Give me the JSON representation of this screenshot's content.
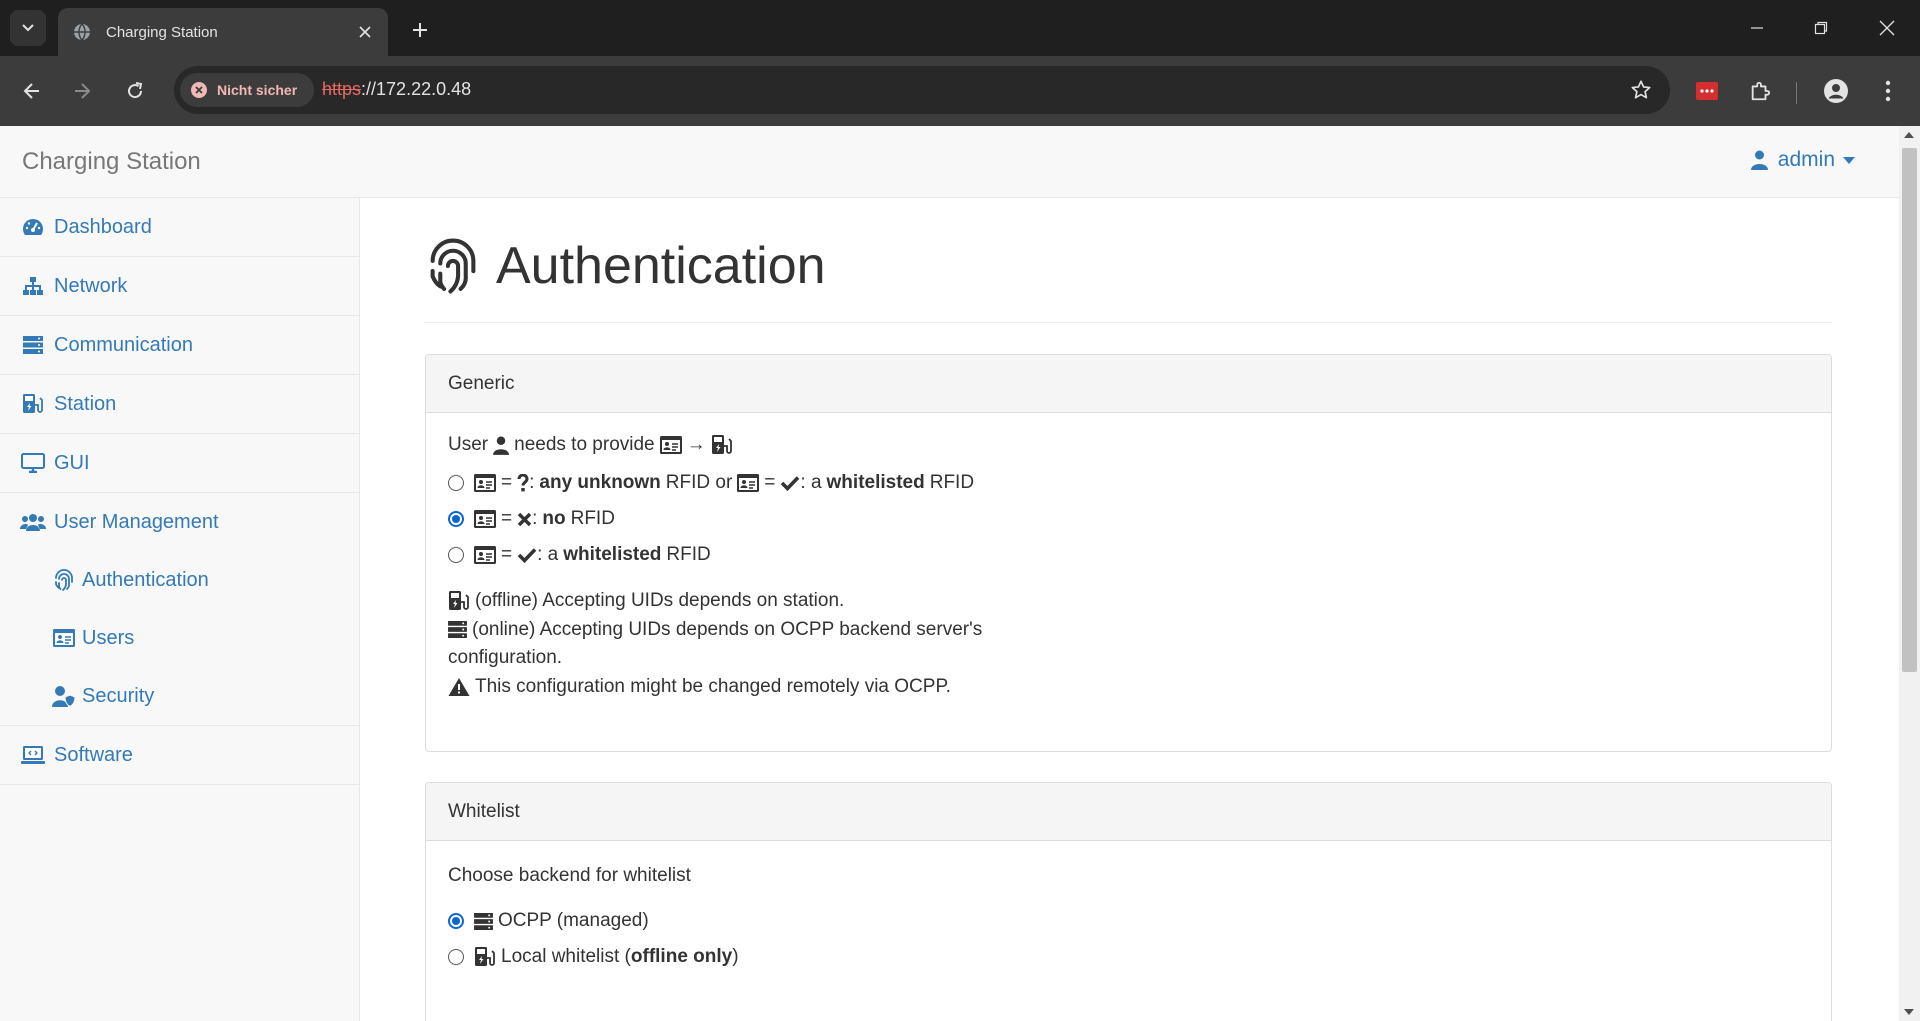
{
  "browser": {
    "tab_title": "Charging Station",
    "security_label": "Nicht sicher",
    "url_scheme": "https",
    "url_rest": "://172.22.0.48"
  },
  "navbar": {
    "brand": "Charging Station",
    "user": "admin"
  },
  "sidebar": {
    "items": [
      {
        "label": "Dashboard",
        "icon": "dashboard-icon"
      },
      {
        "label": "Network",
        "icon": "sitemap-icon"
      },
      {
        "label": "Communication",
        "icon": "server-icon"
      },
      {
        "label": "Station",
        "icon": "charging-station-icon"
      },
      {
        "label": "GUI",
        "icon": "desktop-icon"
      },
      {
        "label": "User Management",
        "icon": "users-icon"
      },
      {
        "label": "Software",
        "icon": "laptop-code-icon"
      }
    ],
    "sub_items": [
      {
        "label": "Authentication",
        "icon": "fingerprint-icon"
      },
      {
        "label": "Users",
        "icon": "id-card-icon"
      },
      {
        "label": "Security",
        "icon": "user-shield-icon"
      }
    ]
  },
  "main": {
    "title": "Authentication",
    "generic": {
      "heading": "Generic",
      "intro_user": "User",
      "intro_needs": "needs to provide",
      "arrow": "→",
      "eq": "=",
      "opt1_colon": ":",
      "opt1_bold1": "any unknown",
      "opt1_text1": "RFID or",
      "opt1_text2": ": a",
      "opt1_bold2": "whitelisted",
      "opt1_text3": "RFID",
      "opt2_colon": ":",
      "opt2_bold": "no",
      "opt2_text": "RFID",
      "opt3_text1": ": a",
      "opt3_bold": "whitelisted",
      "opt3_text2": "RFID",
      "selected_option": 2,
      "note1": "(offline) Accepting UIDs depends on station.",
      "note2a": "(online) Accepting UIDs depends on OCPP backend server's",
      "note2b": "configuration.",
      "note3": "This configuration might be changed remotely via OCPP."
    },
    "whitelist": {
      "heading": "Whitelist",
      "prompt": "Choose backend for whitelist",
      "opt1": "OCPP (managed)",
      "opt2_text": "Local whitelist (",
      "opt2_bold": "offline only",
      "opt2_close": ")",
      "selected_option": 1
    }
  },
  "colors": {
    "link": "#337ab7",
    "radio_checked": "#0b67d0",
    "insecure_red": "#e46962"
  }
}
